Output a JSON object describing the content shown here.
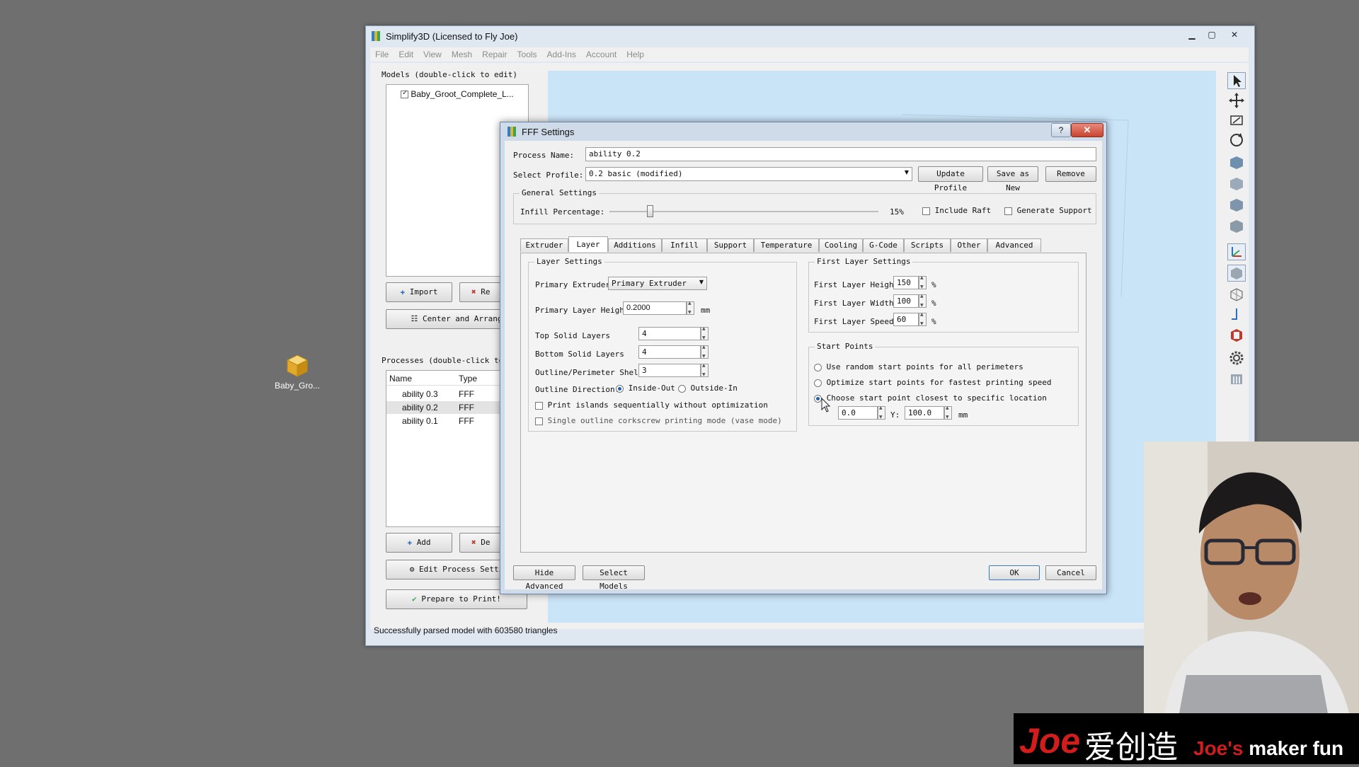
{
  "desktop": {
    "icon_label": "Baby_Gro..."
  },
  "main_window": {
    "title": "Simplify3D (Licensed to Fly Joe)",
    "controls": {
      "minimize": "▁",
      "maximize": "▢",
      "close": "✕"
    },
    "menu": [
      "File",
      "Edit",
      "View",
      "Mesh",
      "Repair",
      "Tools",
      "Add-Ins",
      "Account",
      "Help"
    ],
    "models_label": "Models (double-click to edit)",
    "models": [
      {
        "name": "Baby_Groot_Complete_L...",
        "checked": true
      }
    ],
    "import_button": "Import",
    "remove_models_button": "Re",
    "center_arrange_button": "Center and Arrang",
    "processes_label": "Processes (double-click to",
    "process_columns": [
      "Name",
      "Type"
    ],
    "processes": [
      {
        "name": "ability 0.3",
        "type": "FFF"
      },
      {
        "name": "ability 0.2",
        "type": "FFF"
      },
      {
        "name": "ability 0.1",
        "type": "FFF"
      }
    ],
    "add_button": "Add",
    "delete_button": "De",
    "edit_process_button": "Edit Process Setti",
    "prepare_button": "Prepare to Print!",
    "status": "Successfully parsed model with 603580 triangles"
  },
  "dialog": {
    "title": "FFF Settings",
    "help": "?",
    "close": "✕",
    "process_name_label": "Process Name:",
    "process_name_value": "ability 0.2",
    "select_profile_label": "Select Profile:",
    "select_profile_value": "0.2 basic (modified)",
    "update_profile_button": "Update Profile",
    "save_as_new_button": "Save as New",
    "remove_button": "Remove",
    "general_settings_title": "General Settings",
    "infill_label": "Infill Percentage:",
    "infill_value": "15%",
    "infill_fraction": 0.15,
    "include_raft_label": "Include Raft",
    "include_raft": false,
    "generate_support_label": "Generate Support",
    "generate_support": false,
    "tabs": [
      "Extruder",
      "Layer",
      "Additions",
      "Infill",
      "Support",
      "Temperature",
      "Cooling",
      "G-Code",
      "Scripts",
      "Other",
      "Advanced"
    ],
    "active_tab": "Layer",
    "layer_settings": {
      "title": "Layer Settings",
      "primary_extruder_label": "Primary Extruder",
      "primary_extruder_value": "Primary Extruder",
      "primary_layer_height_label": "Primary Layer Height",
      "primary_layer_height_value": "0.2000",
      "mm": "mm",
      "top_solid_layers_label": "Top Solid Layers",
      "top_solid_layers_value": "4",
      "bottom_solid_layers_label": "Bottom Solid Layers",
      "bottom_solid_layers_value": "4",
      "outline_shells_label": "Outline/Perimeter Shells",
      "outline_shells_value": "3",
      "outline_direction_label": "Outline Direction:",
      "inside_out_label": "Inside-Out",
      "outside_in_label": "Outside-In",
      "print_islands_label": "Print islands sequentially without optimization",
      "single_outline_label": "Single outline corkscrew printing mode (vase mode)"
    },
    "first_layer_settings": {
      "title": "First Layer Settings",
      "height_label": "First Layer Height",
      "height_value": "150",
      "width_label": "First Layer Width",
      "width_value": "100",
      "speed_label": "First Layer Speed",
      "speed_value": "60",
      "percent": "%"
    },
    "start_points": {
      "title": "Start Points",
      "option1": "Use random start points for all perimeters",
      "option2": "Optimize start points for fastest printing speed",
      "option3": "Choose start point closest to specific location",
      "selected": 3,
      "x_value": "0.0",
      "y_label": "Y:",
      "y_value": "100.0",
      "mm": "mm"
    },
    "hide_advanced_button": "Hide Advanced",
    "select_models_button": "Select Models",
    "ok_button": "OK",
    "cancel_button": "Cancel"
  },
  "banner": {
    "joe": "Joe",
    "zh": "爱创造",
    "en_joe": "Joe's",
    "en_rest": " maker fun"
  },
  "colors": {
    "accent": "#1d5fb0",
    "viewport": "#c9e3f7",
    "banner_red": "#d31c1c"
  }
}
